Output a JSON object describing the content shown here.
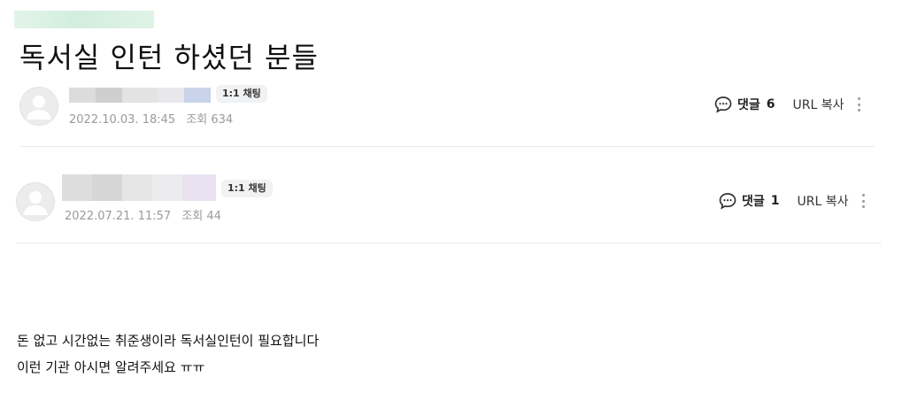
{
  "page": {
    "title": "독서실 인턴 하셨던 분들"
  },
  "posts": [
    {
      "chat_badge": "1:1 채팅",
      "date": "2022.10.03. 18:45",
      "views_label": "조회",
      "views": "634",
      "comment_label": "댓글",
      "comment_count": "6",
      "url_copy_label": "URL 복사"
    },
    {
      "chat_badge": "1:1 채팅",
      "date": "2022.07.21. 11:57",
      "views_label": "조회",
      "views": "44",
      "comment_label": "댓글",
      "comment_count": "1",
      "url_copy_label": "URL 복사"
    }
  ],
  "content": {
    "lines": [
      "돈 없고 시간없는 취준생이라  독서실인턴이 필요합니다",
      "이런 기관 아시면 알려주세요 ㅠㅠ"
    ]
  },
  "icons": {
    "avatar": "default-profile-icon",
    "comment": "speech-bubble-icon",
    "more": "vertical-ellipsis-icon"
  },
  "colors": {
    "divider": "#ebebeb",
    "meta_text": "#9a9a9a",
    "badge_bg": "#f1f2f4"
  }
}
